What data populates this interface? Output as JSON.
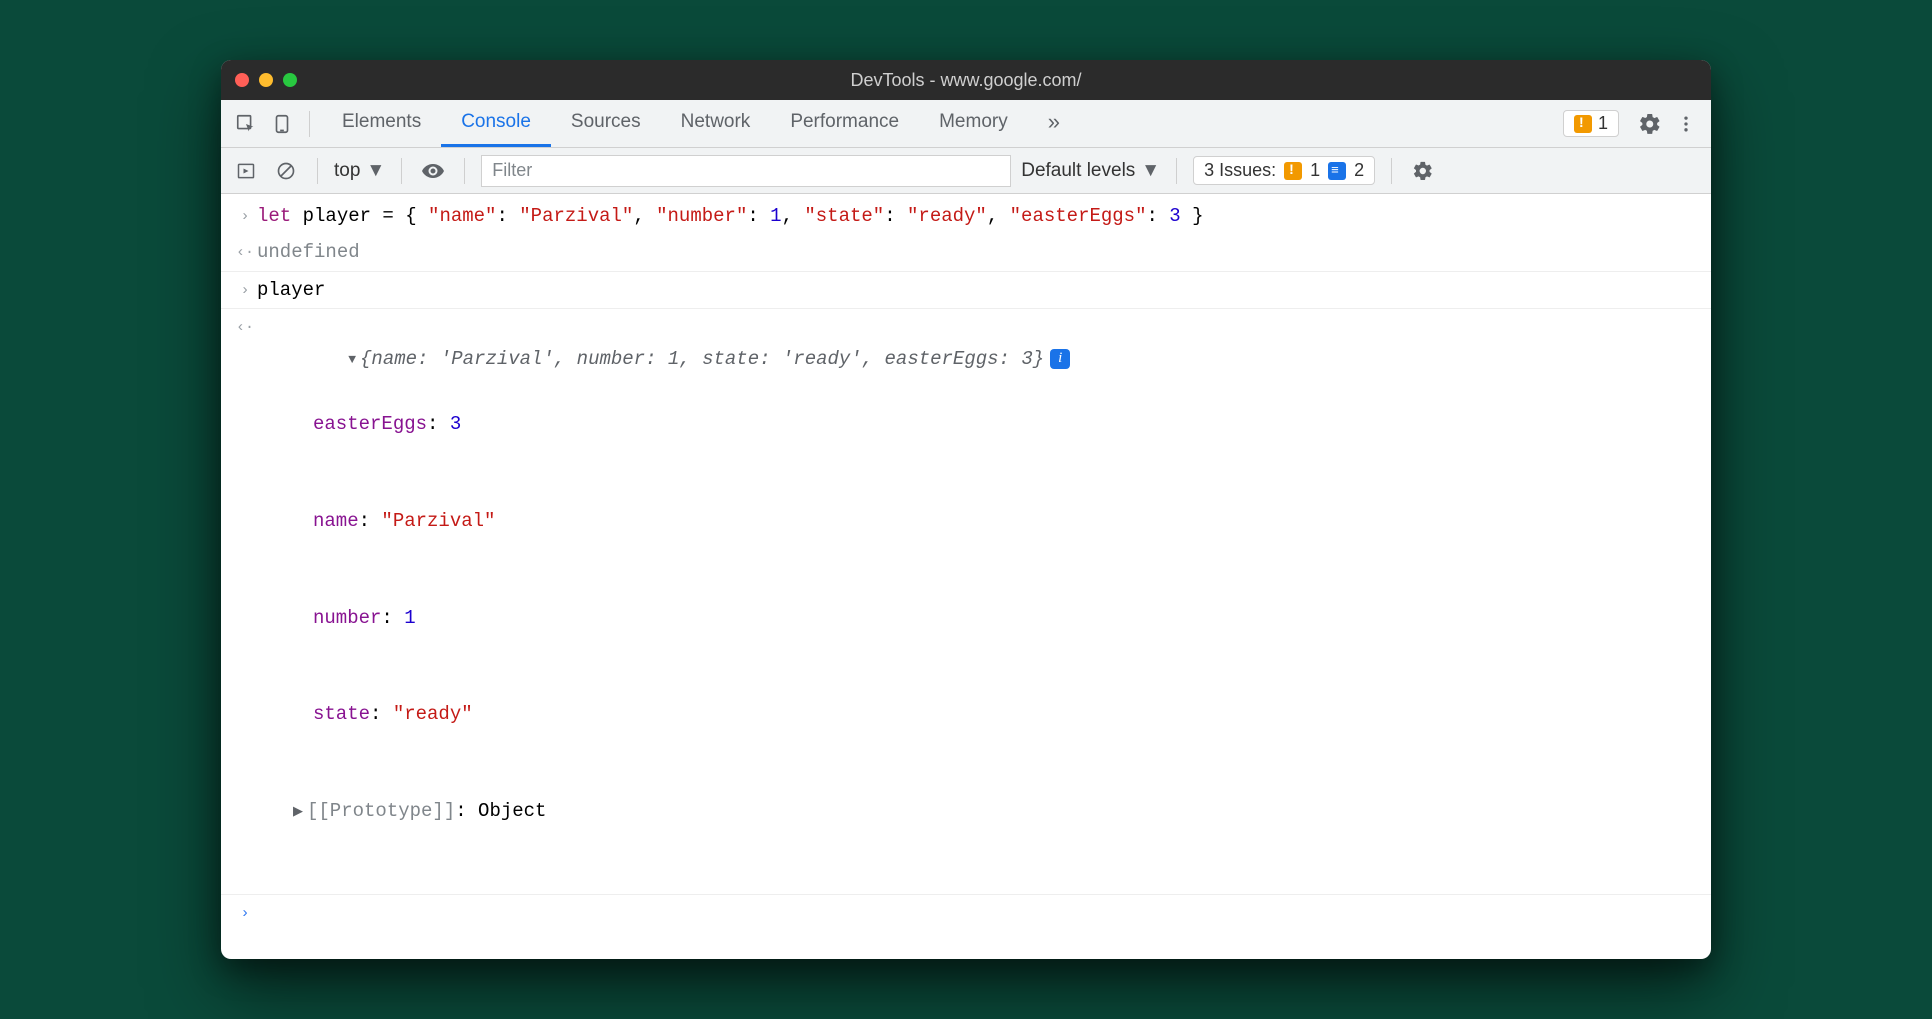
{
  "window": {
    "title": "DevTools - www.google.com/"
  },
  "tabs": {
    "elements": "Elements",
    "console": "Console",
    "sources": "Sources",
    "network": "Network",
    "performance": "Performance",
    "memory": "Memory"
  },
  "warnBadge": {
    "count": "1"
  },
  "toolbar": {
    "context": "top",
    "filterPlaceholder": "Filter",
    "levels": "Default levels",
    "issuesLabel": "3 Issues:",
    "issuesWarn": "1",
    "issuesInfo": "2"
  },
  "console": {
    "line1": {
      "kw": "let",
      "rest1": " player = { ",
      "k1": "\"name\"",
      "v1": "\"Parzival\"",
      "k2": "\"number\"",
      "v2": "1",
      "k3": "\"state\"",
      "v3": "\"ready\"",
      "k4": "\"easterEggs\"",
      "v4": "3",
      "close": " }"
    },
    "undef": "undefined",
    "line2": "player",
    "summary": "{name: 'Parzival', number: 1, state: 'ready', easterEggs: 3}",
    "props": {
      "p1k": "easterEggs",
      "p1v": "3",
      "p2k": "name",
      "p2v": "\"Parzival\"",
      "p3k": "number",
      "p3v": "1",
      "p4k": "state",
      "p4v": "\"ready\""
    },
    "protoLabel": "[[Prototype]]",
    "protoVal": "Object"
  }
}
